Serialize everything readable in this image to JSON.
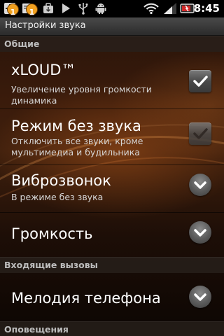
{
  "status_bar": {
    "notification_count_1": "1",
    "notification_count_2": "1",
    "time": "8:45",
    "icons": [
      "add-notification-icon",
      "notification-badge-icon",
      "notification-badge-icon",
      "download-icon",
      "play-icon",
      "usb-icon",
      "android-debug-icon",
      "wifi-icon",
      "signal-icon",
      "battery-icon"
    ]
  },
  "title_bar": {
    "title": "Настройки звука"
  },
  "sections": {
    "general": "Общие",
    "incoming_calls": "Входящие вызовы",
    "notifications": "Оповещения"
  },
  "settings": [
    {
      "title": "xLOUD™",
      "summary": "Увеличение уровня громкости динамика",
      "control": "checkbox",
      "checked": true,
      "enabled": true
    },
    {
      "title": "Режим без звука",
      "summary": "Отключить все звуки, кроме мультимедиа и будильника",
      "control": "checkbox",
      "checked": true,
      "enabled": false
    },
    {
      "title": "Виброзвонок",
      "summary": "В режиме без звука",
      "control": "expander"
    },
    {
      "title": "Громкость",
      "summary": "",
      "control": "expander"
    },
    {
      "title": "Мелодия телефона",
      "summary": "",
      "control": "expander"
    }
  ],
  "colors": {
    "background": "#3a1b0b",
    "status_bar": "#000000",
    "title_bar": "#2b2b2b",
    "section_header": "#28201c",
    "text_primary": "#ffffff",
    "text_secondary": "#d6d6d6",
    "notification_badge": "#f0a020"
  }
}
